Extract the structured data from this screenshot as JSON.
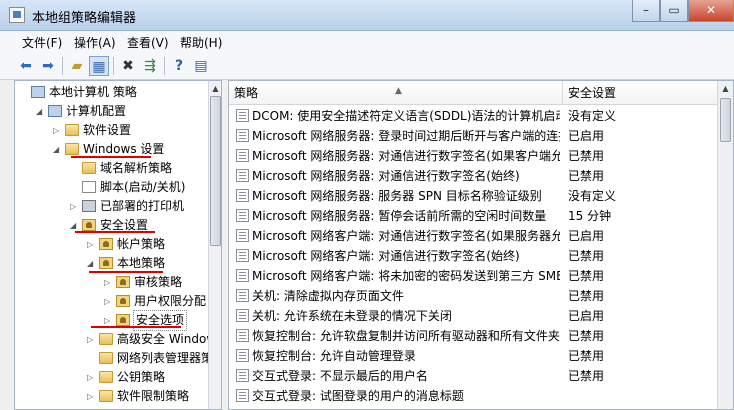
{
  "window": {
    "title": "本地组策略编辑器",
    "buttons": {
      "minimize": "–",
      "maximize": "▭",
      "close": "✕"
    }
  },
  "menu": [
    "文件(F)",
    "操作(A)",
    "查看(V)",
    "帮助(H)"
  ],
  "toolbar_icons": [
    "back-icon",
    "forward-icon",
    "up-folder-icon",
    "show-hide-tree-icon",
    "delete-icon",
    "export-list-icon",
    "help-icon",
    "properties-icon"
  ],
  "tree": [
    {
      "label": "本地计算机 策略",
      "depth": 0,
      "twisty": "",
      "icon": "pc"
    },
    {
      "label": "计算机配置",
      "depth": 1,
      "twisty": "◢",
      "icon": "pc"
    },
    {
      "label": "软件设置",
      "depth": 2,
      "twisty": "▷",
      "icon": "folder"
    },
    {
      "label": "Windows 设置",
      "depth": 2,
      "twisty": "◢",
      "icon": "folder"
    },
    {
      "label": "域名解析策略",
      "depth": 3,
      "twisty": "",
      "icon": "folder"
    },
    {
      "label": "脚本(启动/关机)",
      "depth": 3,
      "twisty": "",
      "icon": "doc"
    },
    {
      "label": "已部署的打印机",
      "depth": 3,
      "twisty": "▷",
      "icon": "printer"
    },
    {
      "label": "安全设置",
      "depth": 3,
      "twisty": "◢",
      "icon": "shield"
    },
    {
      "label": "帐户策略",
      "depth": 4,
      "twisty": "▷",
      "icon": "shield"
    },
    {
      "label": "本地策略",
      "depth": 4,
      "twisty": "◢",
      "icon": "shield"
    },
    {
      "label": "审核策略",
      "depth": 5,
      "twisty": "▷",
      "icon": "shield"
    },
    {
      "label": "用户权限分配",
      "depth": 5,
      "twisty": "▷",
      "icon": "shield"
    },
    {
      "label": "安全选项",
      "depth": 5,
      "twisty": "▷",
      "icon": "shield"
    },
    {
      "label": "高级安全 Windows",
      "depth": 4,
      "twisty": "▷",
      "icon": "folder"
    },
    {
      "label": "网络列表管理器策略",
      "depth": 4,
      "twisty": "",
      "icon": "folder"
    },
    {
      "label": "公钥策略",
      "depth": 4,
      "twisty": "▷",
      "icon": "folder"
    },
    {
      "label": "软件限制策略",
      "depth": 4,
      "twisty": "▷",
      "icon": "folder"
    }
  ],
  "columns": {
    "policy": "策略",
    "setting": "安全设置"
  },
  "rows": [
    {
      "policy": "DCOM: 使用安全描述符定义语言(SDDL)语法的计算机启动...",
      "setting": "没有定义"
    },
    {
      "policy": "Microsoft 网络服务器: 登录时间过期后断开与客户端的连接",
      "setting": "已启用"
    },
    {
      "policy": "Microsoft 网络服务器: 对通信进行数字签名(如果客户端允...",
      "setting": "已禁用"
    },
    {
      "policy": "Microsoft 网络服务器: 对通信进行数字签名(始终)",
      "setting": "已禁用"
    },
    {
      "policy": "Microsoft 网络服务器: 服务器 SPN 目标名称验证级别",
      "setting": "没有定义"
    },
    {
      "policy": "Microsoft 网络服务器: 暂停会话前所需的空闲时间数量",
      "setting": "15 分钟"
    },
    {
      "policy": "Microsoft 网络客户端: 对通信进行数字签名(如果服务器允...",
      "setting": "已启用"
    },
    {
      "policy": "Microsoft 网络客户端: 对通信进行数字签名(始终)",
      "setting": "已禁用"
    },
    {
      "policy": "Microsoft 网络客户端: 将未加密的密码发送到第三方 SMB...",
      "setting": "已禁用"
    },
    {
      "policy": "关机: 清除虚拟内存页面文件",
      "setting": "已禁用"
    },
    {
      "policy": "关机: 允许系统在未登录的情况下关闭",
      "setting": "已启用"
    },
    {
      "policy": "恢复控制台: 允许软盘复制并访问所有驱动器和所有文件夹",
      "setting": "已禁用"
    },
    {
      "policy": "恢复控制台: 允许自动管理登录",
      "setting": "已禁用"
    },
    {
      "policy": "交互式登录: 不显示最后的用户名",
      "setting": "已禁用"
    },
    {
      "policy": "交互式登录: 试图登录的用户的消息标题",
      "setting": ""
    }
  ]
}
